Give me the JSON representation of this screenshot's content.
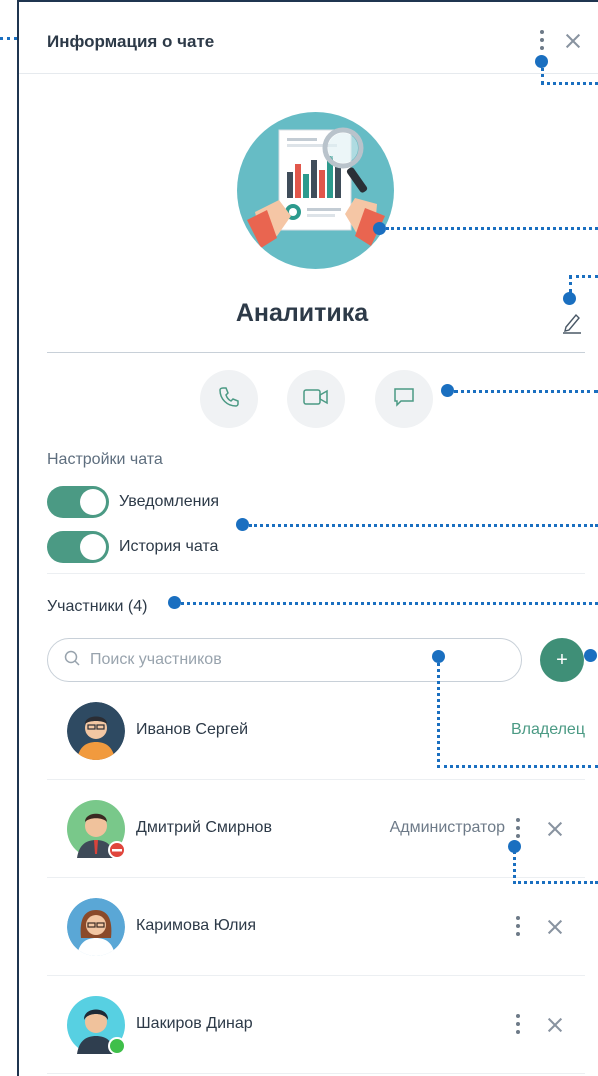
{
  "header": {
    "title": "Информация о чате"
  },
  "chat": {
    "name": "Аналитика"
  },
  "settings": {
    "section_label": "Настройки чата",
    "toggles": [
      {
        "label": "Уведомления",
        "on": true
      },
      {
        "label": "История чата",
        "on": true
      }
    ]
  },
  "members": {
    "title": "Участники (4)",
    "search_placeholder": "Поиск участников",
    "add_label": "+",
    "list": [
      {
        "name": "Иванов Сергей",
        "role": "Владелец"
      },
      {
        "name": "Дмитрий Смирнов",
        "role": "Администратор"
      },
      {
        "name": "Каримова Юлия",
        "role": ""
      },
      {
        "name": "Шакиров Динар",
        "role": ""
      }
    ]
  },
  "colors": {
    "accent": "#4b9a84",
    "callout": "#1a6fc0",
    "border": "#1f3550"
  }
}
